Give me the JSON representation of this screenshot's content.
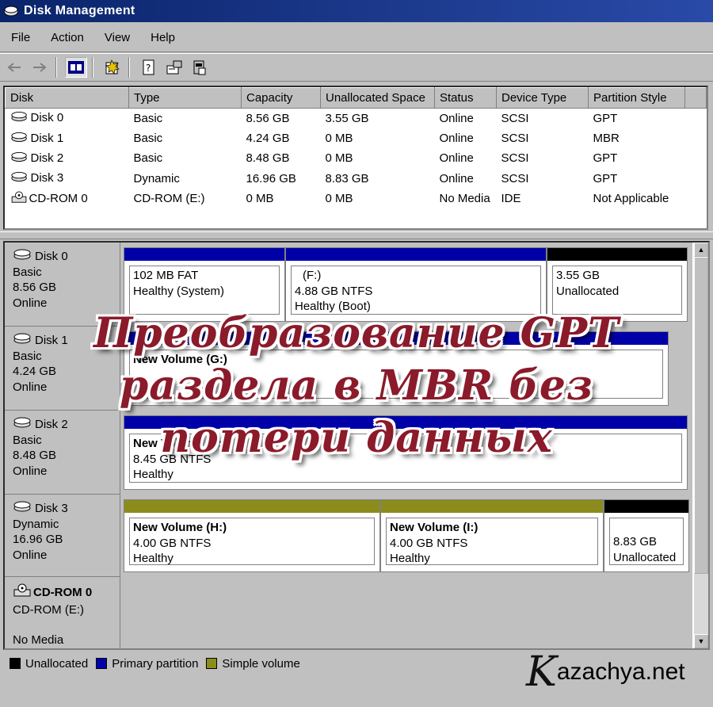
{
  "window": {
    "title": "Disk Management"
  },
  "menu": [
    "File",
    "Action",
    "View",
    "Help"
  ],
  "toolbar": [
    "back-icon",
    "forward-icon",
    "disk-list-view-icon",
    "properties-icon",
    "help-icon",
    "refresh-icon",
    "rescan-icon",
    "console-icon"
  ],
  "disk_list": {
    "columns": [
      "Disk",
      "Type",
      "Capacity",
      "Unallocated Space",
      "Status",
      "Device Type",
      "Partition Style"
    ],
    "rows": [
      [
        "Disk 0",
        "Basic",
        "8.56 GB",
        "3.55 GB",
        "Online",
        "SCSI",
        "GPT"
      ],
      [
        "Disk 1",
        "Basic",
        "4.24 GB",
        "0 MB",
        "Online",
        "SCSI",
        "MBR"
      ],
      [
        "Disk 2",
        "Basic",
        "8.48 GB",
        "0 MB",
        "Online",
        "SCSI",
        "GPT"
      ],
      [
        "Disk 3",
        "Dynamic",
        "16.96 GB",
        "8.83 GB",
        "Online",
        "SCSI",
        "GPT"
      ],
      [
        "CD-ROM 0",
        "CD-ROM (E:)",
        "0 MB",
        "0 MB",
        "No Media",
        "IDE",
        "Not Applicable"
      ]
    ]
  },
  "graphical": {
    "disk0": {
      "name": "Disk 0",
      "type": "Basic",
      "size": "8.56 GB",
      "status": "Online",
      "v1": {
        "l1": "102 MB FAT",
        "l2": "Healthy (System)"
      },
      "v2": {
        "l1": "(F:)",
        "l2": "4.88 GB NTFS",
        "l3": "Healthy (Boot)"
      },
      "v3": {
        "l1": "3.55 GB",
        "l2": "Unallocated"
      }
    },
    "disk1": {
      "name": "Disk 1",
      "type": "Basic",
      "size": "4.24 GB",
      "status": "Online",
      "v1": {
        "l1": "New Volume (G:)"
      }
    },
    "disk2": {
      "name": "Disk 2",
      "type": "Basic",
      "size": "8.48 GB",
      "status": "Online",
      "v1": {
        "l1": "New Volume (E:)",
        "l2": "8.45 GB NTFS",
        "l3": "Healthy"
      }
    },
    "disk3": {
      "name": "Disk 3",
      "type": "Dynamic",
      "size": "16.96 GB",
      "status": "Online",
      "v1": {
        "l1": "New Volume (H:)",
        "l2": "4.00 GB NTFS",
        "l3": "Healthy"
      },
      "v2": {
        "l1": "New Volume (I:)",
        "l2": "4.00 GB NTFS",
        "l3": "Healthy"
      },
      "v3": {
        "l1": "8.83 GB",
        "l2": "Unallocated"
      }
    },
    "cdrom": {
      "name": "CD-ROM 0",
      "type": "CD-ROM (E:)",
      "status": "No Media"
    }
  },
  "legend": [
    "Unallocated",
    "Primary partition",
    "Simple volume"
  ],
  "colors": {
    "unallocated": "#000000",
    "primary": "#0000a8",
    "simple": "#8c8c1c",
    "overlay_text": "#8b1a2a"
  },
  "overlay": {
    "line1": "Преобразование GPT",
    "line2": "раздела в MBR без",
    "line3": "потери данных"
  },
  "watermark": {
    "k": "K",
    "rest": "azachya.net"
  }
}
